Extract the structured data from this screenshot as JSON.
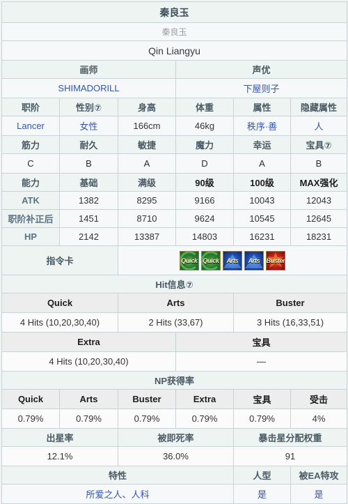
{
  "servant": {
    "name_cn": "秦良玉",
    "name_jp": "秦良玉",
    "name_romaji": "Qin Liangyu"
  },
  "credits": {
    "illustrator_label": "画师",
    "illustrator_value": "SHIMADORILL",
    "va_label": "声优",
    "va_value": "下屋则子"
  },
  "profile": {
    "headers": [
      "职阶",
      "性别⑦",
      "身高",
      "体重",
      "属性",
      "隐藏属性"
    ],
    "values": [
      "Lancer",
      "女性",
      "166cm",
      "46kg",
      "秩序·善",
      "人"
    ]
  },
  "params": {
    "headers": [
      "筋力",
      "耐久",
      "敏捷",
      "魔力",
      "幸运",
      "宝具⑦"
    ],
    "values": [
      "C",
      "B",
      "A",
      "D",
      "A",
      "B"
    ]
  },
  "stats": {
    "headers": [
      "能力",
      "基础",
      "满级",
      "90级",
      "100级",
      "MAX强化"
    ],
    "rows": [
      {
        "label": "ATK",
        "values": [
          "1382",
          "8295",
          "9166",
          "10043",
          "12043"
        ]
      },
      {
        "label": "职阶补正后",
        "values": [
          "1451",
          "8710",
          "9624",
          "10545",
          "12645"
        ]
      },
      {
        "label": "HP",
        "values": [
          "2142",
          "13387",
          "14803",
          "16231",
          "18231"
        ]
      }
    ]
  },
  "command_cards": {
    "label": "指令卡",
    "cards": [
      {
        "type": "quick",
        "text": "Quick"
      },
      {
        "type": "quick",
        "text": "Quick"
      },
      {
        "type": "arts",
        "text": "Arts"
      },
      {
        "type": "arts",
        "text": "Arts"
      },
      {
        "type": "buster",
        "text": "Buster"
      }
    ]
  },
  "hit_info": {
    "title": "Hit信息⑦",
    "headers_row1": [
      "Quick",
      "Arts",
      "Buster"
    ],
    "values_row1": [
      "4 Hits (10,20,30,40)",
      "2 Hits (33,67)",
      "3 Hits (16,33,51)"
    ],
    "headers_row2": [
      "Extra",
      "宝具"
    ],
    "values_row2": [
      "4 Hits (10,20,30,40)",
      "—"
    ]
  },
  "np_rate": {
    "title": "NP获得率",
    "headers": [
      "Quick",
      "Arts",
      "Buster",
      "Extra",
      "宝具",
      "受击"
    ],
    "values": [
      "0.79%",
      "0.79%",
      "0.79%",
      "0.79%",
      "0.79%",
      "4%"
    ],
    "extra_headers": [
      "出星率",
      "被即死率",
      "暴击星分配权重"
    ],
    "extra_values": [
      "12.1%",
      "36.0%",
      "91"
    ]
  },
  "traits": {
    "headers": [
      "特性",
      "人型",
      "被EA特攻"
    ],
    "values": [
      "所爱之人、人科",
      "是",
      "是"
    ]
  }
}
